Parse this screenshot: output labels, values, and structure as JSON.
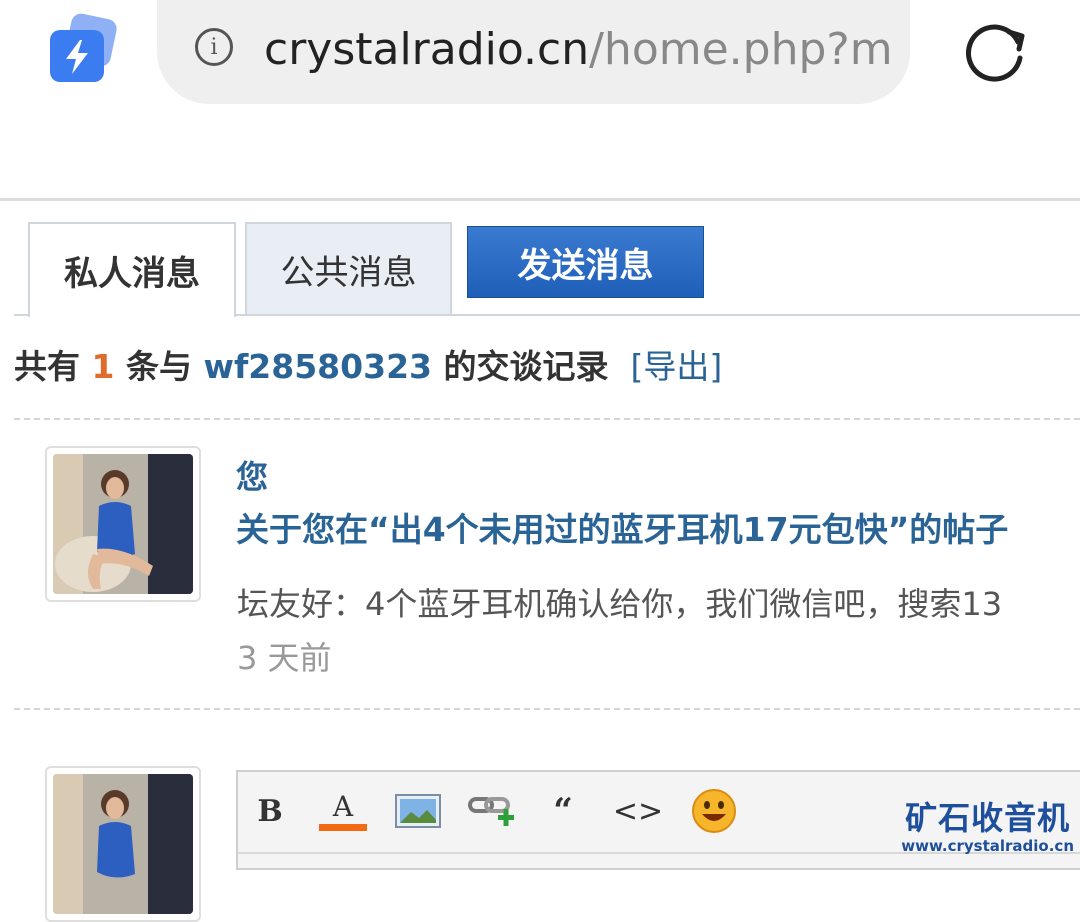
{
  "browser": {
    "url_domain": "crystalradio.cn",
    "url_path": "/home.php?mo",
    "app_icon": "lightning-bolt-icon",
    "info_icon": "info-icon",
    "reload_icon": "reload-icon"
  },
  "tabs": {
    "private_label": "私人消息",
    "public_label": "公共消息",
    "send_label": "发送消息"
  },
  "summary": {
    "prefix": "共有 ",
    "count": "1",
    "middle": " 条与 ",
    "username": "wf28580323",
    "suffix": " 的交谈记录",
    "export_label": "[导出]"
  },
  "message": {
    "from": "您",
    "subject": "关于您在“出4个未用过的蓝牙耳机17元包快”的帖子",
    "body": "坛友好：4个蓝牙耳机确认给你，我们微信吧，搜索13",
    "time": "3 天前"
  },
  "editor": {
    "bold_label": "B",
    "color_label": "A",
    "quote_label": "“",
    "code_label": "<>",
    "accent_color": "#f36a12"
  },
  "watermark": {
    "title": "矿石收音机",
    "url": "www.crystalradio.cn"
  },
  "colors": {
    "link_blue": "#2a6496",
    "count_orange": "#e06c2a",
    "button_blue": "#2a6bc4",
    "watermark_blue": "#1e4f9c"
  }
}
